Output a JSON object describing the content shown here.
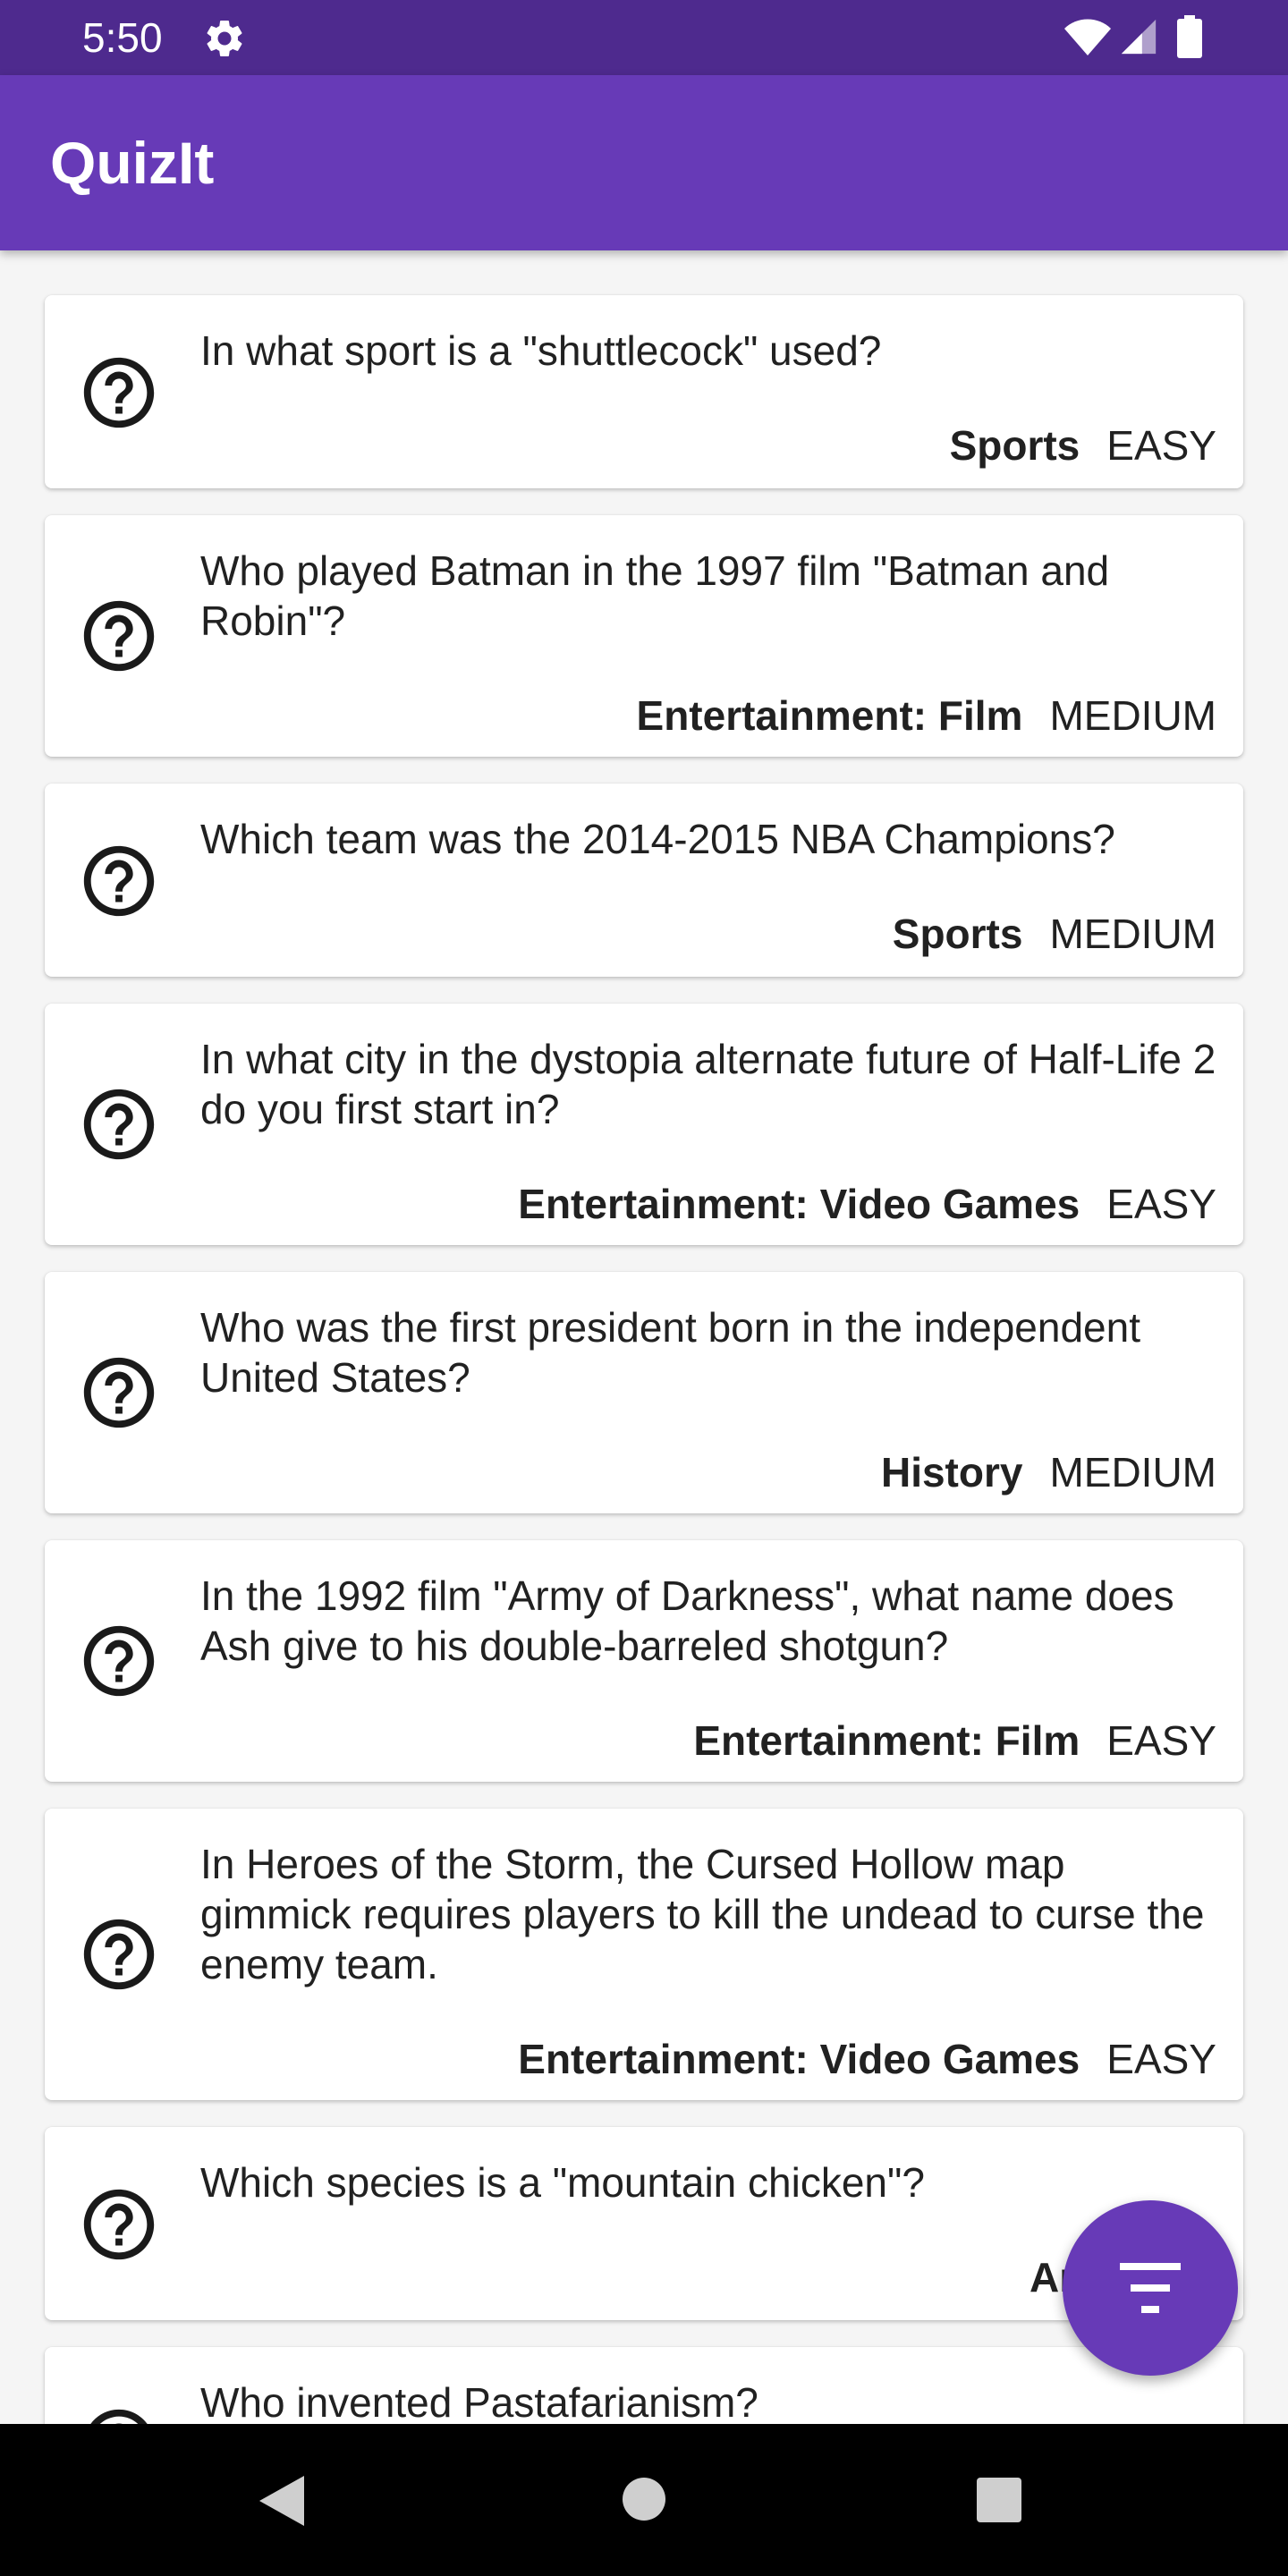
{
  "status_bar": {
    "time": "5:50"
  },
  "app_bar": {
    "title": "QuizIt"
  },
  "questions": [
    {
      "question": "In what sport is a \"shuttlecock\" used?",
      "category": "Sports",
      "difficulty": "EASY"
    },
    {
      "question": "Who played Batman in the 1997 film \"Batman and Robin\"?",
      "category": "Entertainment: Film",
      "difficulty": "MEDIUM"
    },
    {
      "question": "Which team was the 2014-2015 NBA Champions?",
      "category": "Sports",
      "difficulty": "MEDIUM"
    },
    {
      "question": "In what city in the dystopia alternate future of Half-Life 2 do you first start in?",
      "category": "Entertainment: Video Games",
      "difficulty": "EASY"
    },
    {
      "question": "Who was the first president born in the independent United States?",
      "category": "History",
      "difficulty": "MEDIUM"
    },
    {
      "question": "In the 1992 film \"Army of Darkness\", what name does Ash give to his double-barreled shotgun?",
      "category": "Entertainment: Film",
      "difficulty": "EASY"
    },
    {
      "question": "In Heroes of the Storm, the Cursed Hollow map gimmick requires players to kill the undead to curse the enemy team.",
      "category": "Entertainment: Video Games",
      "difficulty": "EASY"
    },
    {
      "question": "Which species is a \"mountain chicken\"?",
      "category": "Animals",
      "difficulty": ""
    },
    {
      "question": "Who invented Pastafarianism?",
      "category": "",
      "difficulty": ""
    }
  ],
  "icons": {
    "question": "help-outline-icon",
    "fab": "filter-list-icon",
    "status": [
      "settings-icon",
      "wifi-icon",
      "cell-signal-icon",
      "battery-icon"
    ],
    "nav": [
      "back-icon",
      "home-icon",
      "recents-icon"
    ]
  },
  "colors": {
    "primary": "#673ab7",
    "primary_dark": "#4e2a8e",
    "background": "#f5f5f5",
    "text": "#212121"
  }
}
